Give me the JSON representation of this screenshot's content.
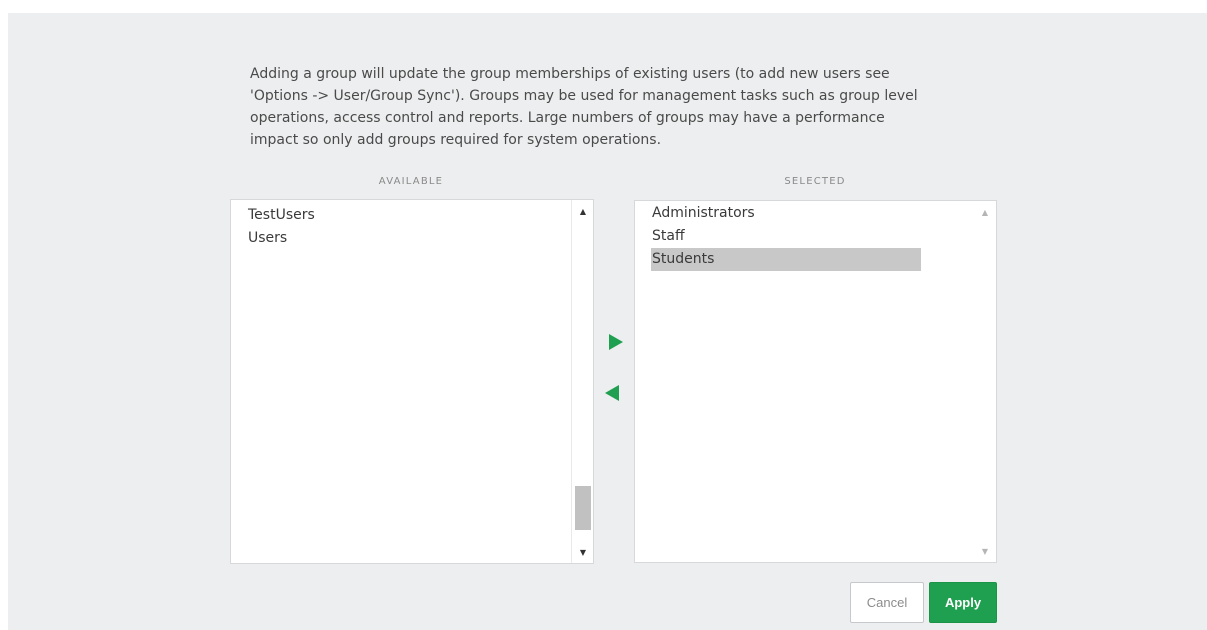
{
  "description": "Adding a group will update the group memberships of existing users (to add new users see\n'Options -> User/Group Sync').  Groups may be used for management tasks such as group level\noperations, access control and reports.  Large numbers of groups may have a performance\nimpact so only add groups required for system operations.",
  "available": {
    "header": "AVAILABLE",
    "items": [
      "TestUsers",
      "Users"
    ]
  },
  "selected": {
    "header": "SELECTED",
    "items": [
      "Administrators",
      "Staff",
      "Students"
    ],
    "highlighted_item": "Students"
  },
  "buttons": {
    "cancel_label": "Cancel",
    "apply_label": "Apply"
  },
  "icons": {
    "move_right": "arrow-right-icon",
    "move_left": "arrow-left-icon",
    "scroll_up": "scroll-up-icon",
    "scroll_down": "scroll-down-icon"
  },
  "colors": {
    "accent": "#1fa050",
    "background": "#edeeef",
    "selection": "#c8c8c8"
  }
}
